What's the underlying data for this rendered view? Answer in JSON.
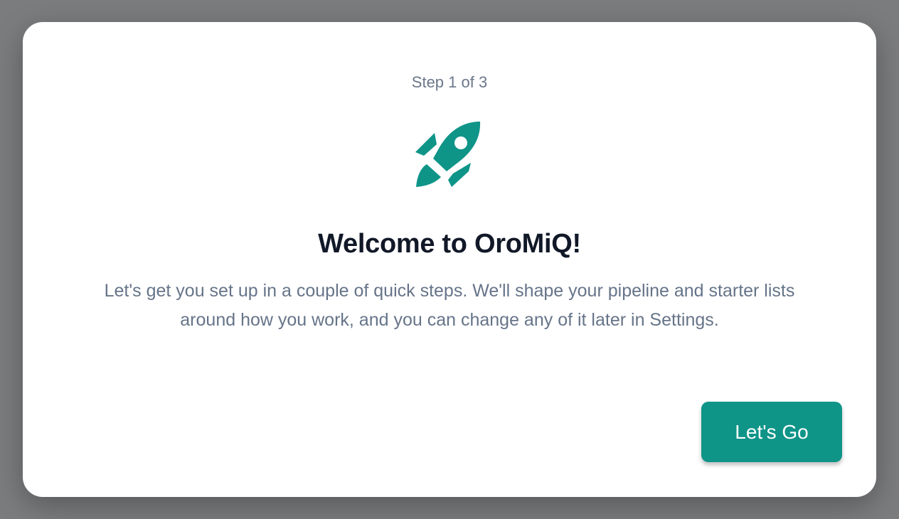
{
  "dialog": {
    "step_label": "Step 1 of 3",
    "icon": "rocket-icon",
    "title": "Welcome to OroMiQ!",
    "description_lines": [
      "Let's get you set up in a couple of quick steps. We'll shape your pipeline and starter lists",
      "around how you work, and you can change any of it later in Settings."
    ],
    "cta_label": "Let's Go"
  },
  "colors": {
    "accent": "#0f9488",
    "title": "#111827",
    "muted_text": "#667489",
    "overlay": "#7b7c7e",
    "surface": "#ffffff"
  }
}
